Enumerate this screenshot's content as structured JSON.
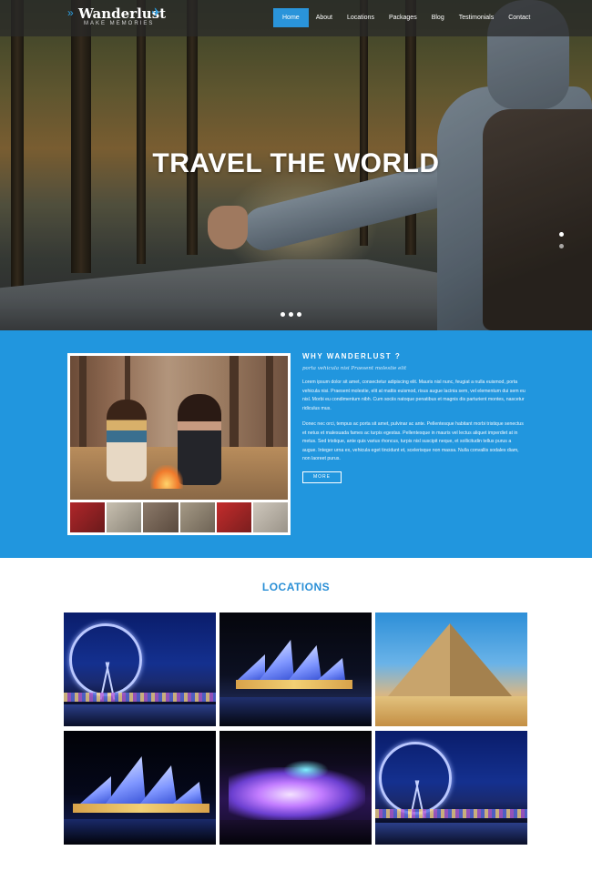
{
  "brand": {
    "name": "Wanderlust",
    "tagline": "MAKE MEMORIES"
  },
  "nav": {
    "items": [
      {
        "label": "Home",
        "active": true
      },
      {
        "label": "About",
        "active": false
      },
      {
        "label": "Locations",
        "active": false
      },
      {
        "label": "Packages",
        "active": false
      },
      {
        "label": "Blog",
        "active": false
      },
      {
        "label": "Testimonials",
        "active": false
      },
      {
        "label": "Contact",
        "active": false
      }
    ]
  },
  "hero": {
    "title": "TRAVEL THE WORLD",
    "slide_count": 3,
    "active_slide": 1
  },
  "why": {
    "heading": "WHY WANDERLUST ?",
    "subheading": "porta vehicula nisi Praesent molestie elit",
    "paragraph1": "Lorem ipsum dolor sit amet, consectetur adipiscing elit. Mauris nisl nunc, feugiat a nulla euismod, porta vehicula nisi. Praesent molestie, elit at mattis euismod, risus augue lacinia sem, vel elementum dui sem eu nisl. Morbi eu condimentum nibh. Cum sociis natoque penatibus et magnis dis parturient montes, nascetur ridiculus mus.",
    "paragraph2": "Donec nec orci, tempus ac porta sit amet, pulvinar ac ante. Pellentesque habitant morbi tristique senectus et netus et malesuada fames ac turpis egestas. Pellentesque in mauris vel lectus aliquet imperdiet at in metus. Sed tristique, ante quis varius rhoncus, turpis nisl suscipit neque, et sollicitudin tellus purus a augue. Integer urna ex, vehicula eget tincidunt et, scelerisque non massa. Nulla convallis sodales diam, non laoreet purus.",
    "more_label": "MORE"
  },
  "locations": {
    "title": "LOCATIONS",
    "tiles": [
      {
        "name": "london-eye-night"
      },
      {
        "name": "sydney-opera-house-night"
      },
      {
        "name": "great-pyramid"
      },
      {
        "name": "sydney-opera-house-night"
      },
      {
        "name": "niagara-falls-lights"
      },
      {
        "name": "london-eye-night"
      }
    ]
  },
  "colors": {
    "accent": "#2a94da",
    "section_blue": "#2196de",
    "nav_bg": "#282828"
  }
}
